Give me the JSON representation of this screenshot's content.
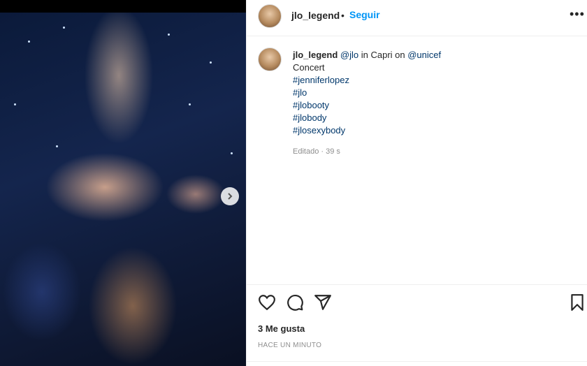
{
  "post": {
    "username": "jlo_legend",
    "follow_label": "Seguir",
    "more_label": "•••",
    "caption": {
      "mention": "@jlo",
      "location_text": " in Capri on ",
      "mention2": "@unicef",
      "line2": "Concert",
      "hashtags": [
        "#jenniferlopez",
        "#jlo",
        "#jlobooty",
        "#jlobody",
        "#jlosexybody"
      ]
    },
    "edited_meta": "Editado · 39 s",
    "likes": "3 Me gusta",
    "time_ago": "HACE UN MINUTO"
  },
  "colors": {
    "accent": "#0095f6",
    "link": "#00376b",
    "text": "#262626",
    "muted": "#8e8e8e"
  },
  "icons": {
    "like": "heart-icon",
    "comment": "comment-icon",
    "share": "send-icon",
    "save": "bookmark-icon",
    "next": "chevron-right-icon"
  }
}
